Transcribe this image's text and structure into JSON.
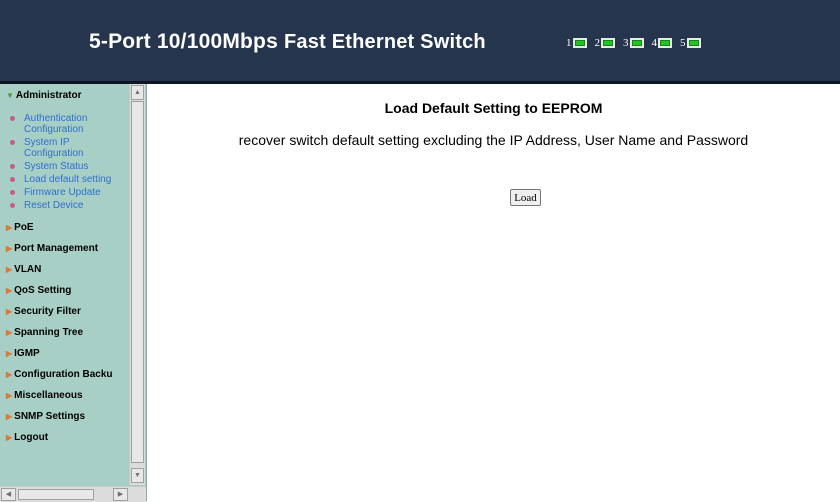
{
  "header": {
    "title_main": "5-Port 10/100Mbps",
    "title_sub": "Fast Ethernet Switch",
    "ports": [
      "1",
      "2",
      "3",
      "4",
      "5"
    ]
  },
  "sidebar": {
    "administrator": {
      "label": "Administrator",
      "items": [
        "Authentication Configuration",
        "System IP Configuration",
        "System Status",
        "Load default setting",
        "Firmware Update",
        "Reset Device"
      ]
    },
    "sections": [
      "PoE",
      "Port Management",
      "VLAN",
      "QoS Setting",
      "Security Filter",
      "Spanning Tree",
      "IGMP",
      "Configuration Backu",
      "Miscellaneous",
      "SNMP Settings",
      "Logout"
    ]
  },
  "main": {
    "title": "Load Default Setting to EEPROM",
    "description": "recover switch default setting excluding the IP Address, User Name and Password",
    "load_button": "Load"
  },
  "colors": {
    "header_bg": "#26354e",
    "sidebar_bg": "#a8cfc5",
    "link": "#2f6fd0",
    "port_led": "#25c226"
  }
}
